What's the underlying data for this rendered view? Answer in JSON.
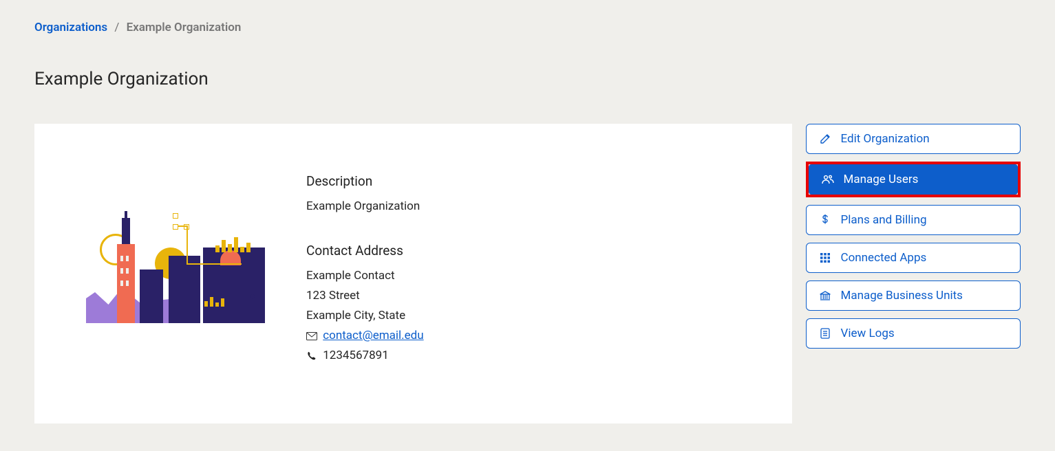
{
  "breadcrumb": {
    "parent": "Organizations",
    "current": "Example Organization"
  },
  "page_title": "Example Organization",
  "description": {
    "label": "Description",
    "value": "Example Organization"
  },
  "contact": {
    "label": "Contact Address",
    "name": "Example Contact",
    "street": "123 Street",
    "city_state": "Example City, State",
    "email": "contact@email.edu",
    "phone": "1234567891"
  },
  "actions": {
    "edit": "Edit Organization",
    "manage_users": "Manage Users",
    "plans_billing": "Plans and Billing",
    "connected_apps": "Connected Apps",
    "manage_bu": "Manage Business Units",
    "view_logs": "View Logs"
  }
}
